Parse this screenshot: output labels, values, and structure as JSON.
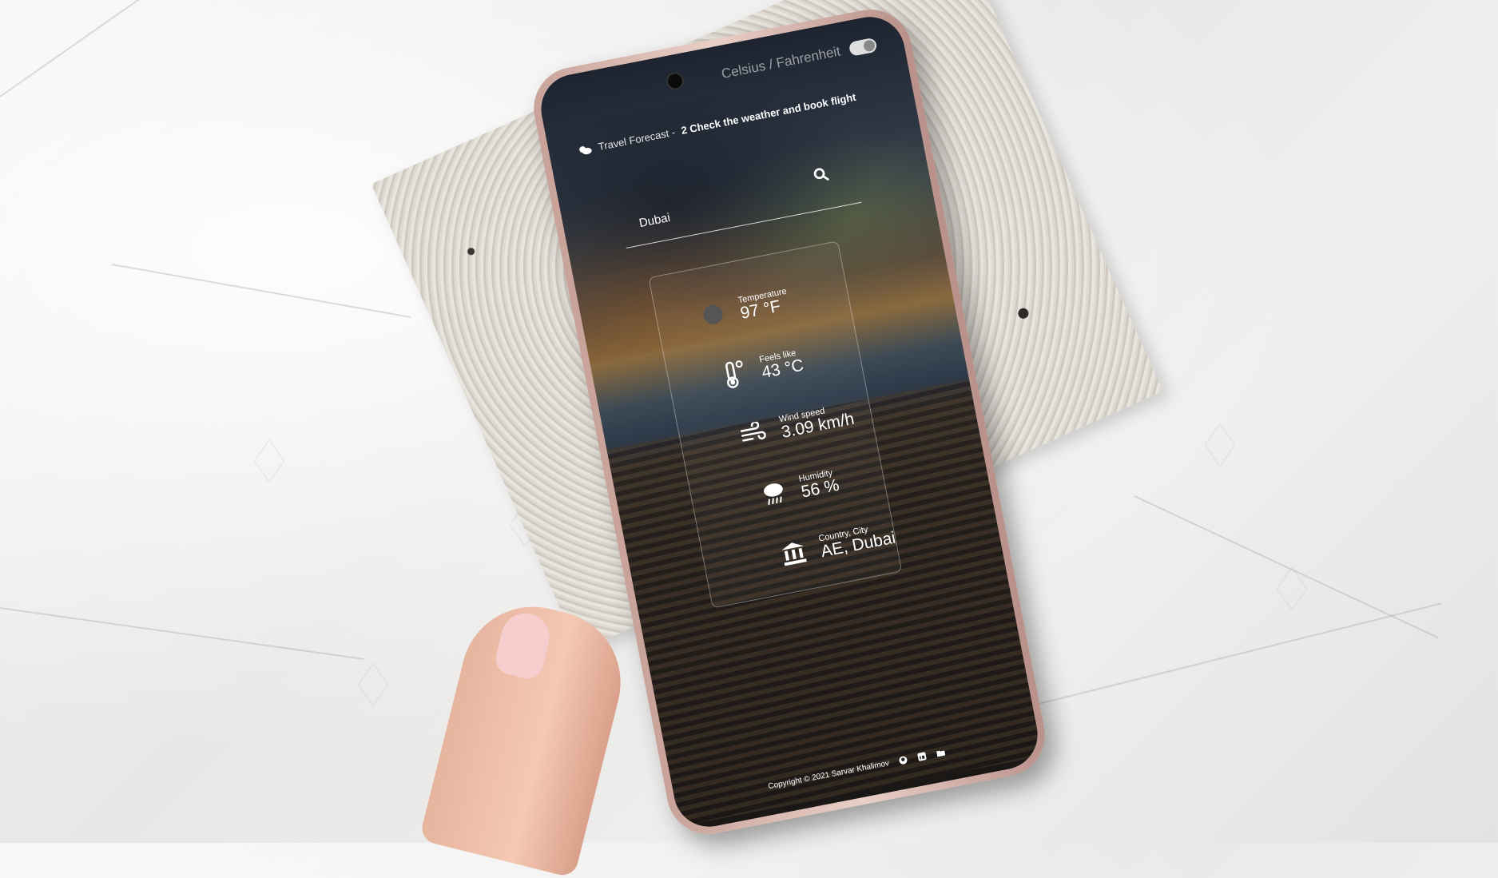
{
  "header": {
    "unit_toggle_label": "Celsius / Fahrenheit",
    "title": "Travel Forecast -",
    "tagline": "2 Check the weather and book flight"
  },
  "search": {
    "value": "Dubai"
  },
  "weather": {
    "temperature": {
      "label": "Temperature",
      "value": "97 °F"
    },
    "feels_like": {
      "label": "Feels like",
      "value": "43 °C"
    },
    "wind": {
      "label": "Wind speed",
      "value": "3.09 km/h"
    },
    "humidity": {
      "label": "Humidity",
      "value": "56 %"
    },
    "location": {
      "label": "Country, City",
      "value": "AE, Dubai"
    }
  },
  "footer": {
    "copyright": "Copyright © 2021 Sarvar Khalimov",
    "icons": [
      "github-icon",
      "linkedin-icon",
      "folder-icon"
    ]
  },
  "colors": {
    "text": "#ffffff",
    "frame": "#d9b3a8"
  }
}
